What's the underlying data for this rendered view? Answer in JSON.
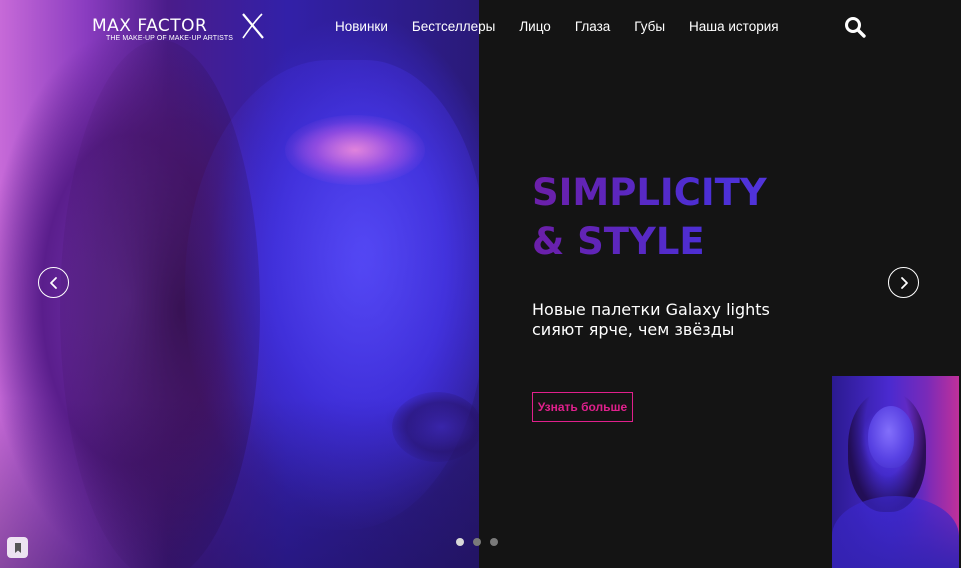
{
  "brand": {
    "wordmark": "MAX FACTOR",
    "tagline": "THE MAKE-UP OF MAKE-UP ARTISTS"
  },
  "nav": {
    "items": [
      {
        "label": "Новинки"
      },
      {
        "label": "Бестселлеры"
      },
      {
        "label": "Лицо"
      },
      {
        "label": "Глаза"
      },
      {
        "label": "Губы"
      },
      {
        "label": "Наша история"
      }
    ]
  },
  "search": {
    "icon": "search-icon"
  },
  "hero": {
    "headline_line1": "SIMPLICITY",
    "headline_line2": "& STYLE",
    "subtitle_line1": "Новые палетки Galaxy lights",
    "subtitle_line2": "сияют ярче, чем звёзды",
    "cta_label": "Узнать больше",
    "accent_color": "#e0208c",
    "headline_gradient": [
      "#6c1fa8",
      "#4b2fd6"
    ]
  },
  "carousel": {
    "slides": 3,
    "active_index": 0,
    "prev_icon": "chevron-left-icon",
    "next_icon": "chevron-right-icon"
  },
  "bookmark": {
    "icon": "bookmark-icon"
  }
}
